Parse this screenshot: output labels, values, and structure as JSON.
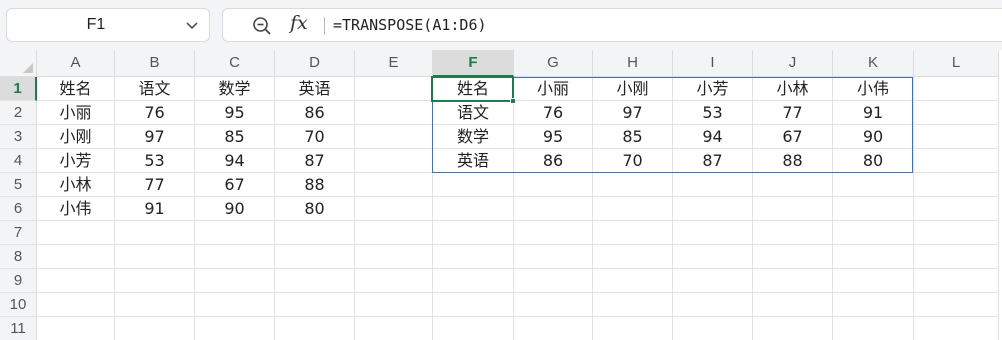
{
  "name_box": {
    "value": "F1"
  },
  "formula_bar": {
    "fx_label": "fx",
    "formula": "=TRANSPOSE(A1:D6)"
  },
  "columns": [
    "A",
    "B",
    "C",
    "D",
    "E",
    "F",
    "G",
    "H",
    "I",
    "J",
    "K",
    "L"
  ],
  "active_column": "F",
  "rows": [
    "1",
    "2",
    "3",
    "4",
    "5",
    "6",
    "7",
    "8",
    "9",
    "10",
    "11"
  ],
  "active_row": "1",
  "cells": {
    "A1": "姓名",
    "B1": "语文",
    "C1": "数学",
    "D1": "英语",
    "A2": "小丽",
    "B2": "76",
    "C2": "95",
    "D2": "86",
    "A3": "小刚",
    "B3": "97",
    "C3": "85",
    "D3": "70",
    "A4": "小芳",
    "B4": "53",
    "C4": "94",
    "D4": "87",
    "A5": "小林",
    "B5": "77",
    "C5": "67",
    "D5": "88",
    "A6": "小伟",
    "B6": "91",
    "C6": "90",
    "D6": "80",
    "F1": "姓名",
    "G1": "小丽",
    "H1": "小刚",
    "I1": "小芳",
    "J1": "小林",
    "K1": "小伟",
    "F2": "语文",
    "G2": "76",
    "H2": "97",
    "I2": "53",
    "J2": "77",
    "K2": "91",
    "F3": "数学",
    "G3": "95",
    "H3": "85",
    "I3": "94",
    "J3": "67",
    "K3": "90",
    "F4": "英语",
    "G4": "86",
    "H4": "70",
    "I4": "87",
    "J4": "88",
    "K4": "80"
  },
  "colors": {
    "accent_green": "#1e7b4a",
    "range_blue": "#3e6fc9",
    "header_bg": "#f3f4f6"
  }
}
